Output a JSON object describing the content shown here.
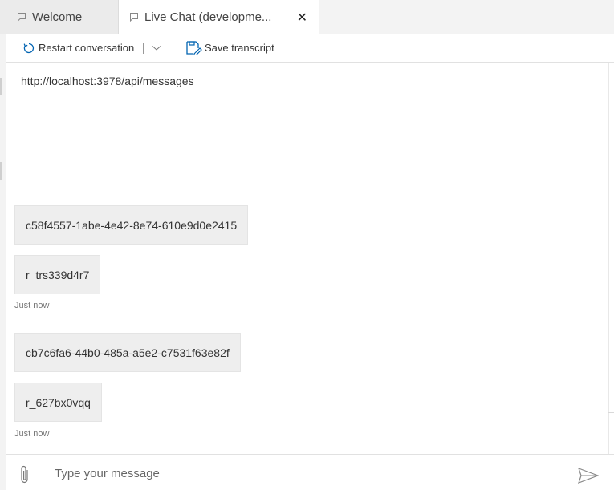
{
  "tabs": [
    {
      "label": "Welcome"
    },
    {
      "label": "Live Chat (developme..."
    }
  ],
  "toolbar": {
    "restart_label": "Restart conversation",
    "save_label": "Save transcript"
  },
  "chat": {
    "endpoint": "http://localhost:3978/api/messages",
    "messages": [
      {
        "text": "c58f4557-1abe-4e42-8e74-610e9d0e2415"
      },
      {
        "text": "r_trs339d4r7",
        "timestamp": "Just now"
      },
      {
        "text": "cb7c6fa6-44b0-485a-a5e2-c7531f63e82f"
      },
      {
        "text": "r_627bx0vqq",
        "timestamp": "Just now"
      }
    ]
  },
  "input": {
    "placeholder": "Type your message",
    "value": ""
  },
  "icons": {
    "tab": "chat-bubble-icon",
    "restart": "restart-icon",
    "dropdown": "chevron-down-icon",
    "save": "save-icon",
    "attach": "paperclip-icon",
    "send": "send-icon",
    "close": "close-icon"
  },
  "colors": {
    "accent": "#0063b1",
    "background": "#f3f3f3",
    "bubble": "#eeeeee"
  }
}
